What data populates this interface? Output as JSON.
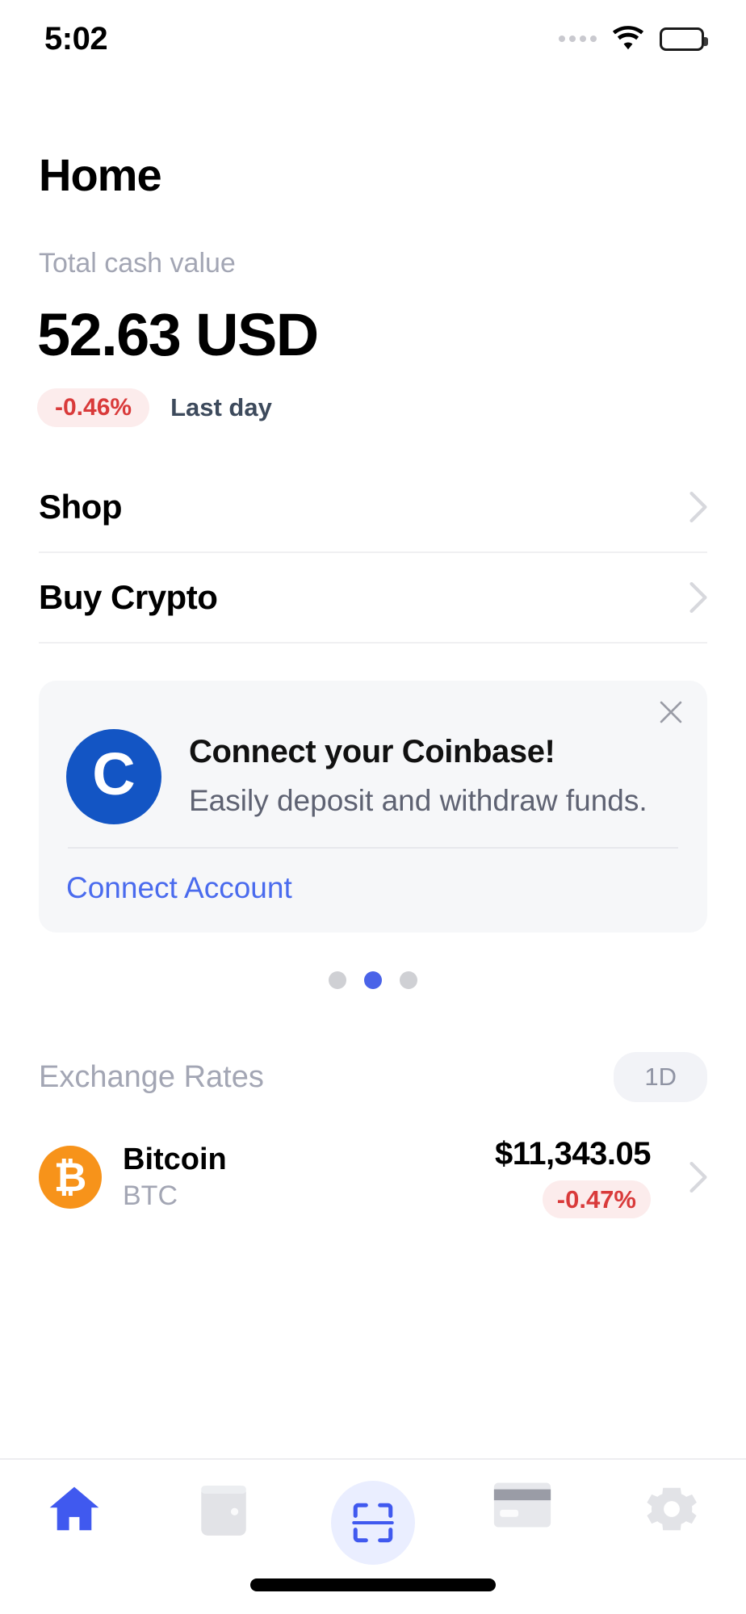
{
  "statusbar": {
    "time": "5:02",
    "signal_icon": "signal-dots-icon",
    "wifi_icon": "wifi-icon",
    "battery_icon": "battery-full-icon"
  },
  "header": {
    "title": "Home",
    "balance_label": "Total cash value",
    "balance_value": "52.63 USD",
    "change_percent": "-0.46%",
    "change_period": "Last day",
    "change_color": "#d93a3a",
    "change_bg": "#fcecec"
  },
  "nav_rows": [
    {
      "label": "Shop",
      "chevron": "chevron-right-icon"
    },
    {
      "label": "Buy Crypto",
      "chevron": "chevron-right-icon"
    }
  ],
  "promo": {
    "close_icon": "close-icon",
    "logo_letter": "C",
    "logo_color": "#1355c4",
    "title": "Connect your Coinbase!",
    "subtitle": "Easily deposit and withdraw funds.",
    "action_label": "Connect Account",
    "action_color": "#4a6bee"
  },
  "carousel": {
    "dots": [
      {
        "active": false
      },
      {
        "active": true
      },
      {
        "active": false
      }
    ],
    "active_color": "#4a63e8",
    "inactive_color": "#cfd0d4"
  },
  "exchange": {
    "title": "Exchange Rates",
    "range_label": "1D",
    "rows": [
      {
        "logo_letter": "₿",
        "logo_color": "#f7931a",
        "name": "Bitcoin",
        "ticker": "BTC",
        "price": "$11,343.05",
        "change": "-0.47%",
        "chevron": "chevron-right-icon"
      }
    ]
  },
  "tabbar": {
    "items": [
      {
        "name": "home-icon",
        "label": "Home",
        "active": true
      },
      {
        "name": "wallet-icon",
        "label": "Wallet",
        "active": false
      },
      {
        "name": "scan-icon",
        "label": "Scan",
        "active": true
      },
      {
        "name": "card-icon",
        "label": "Card",
        "active": false
      },
      {
        "name": "settings-icon",
        "label": "Settings",
        "active": false
      }
    ],
    "active_color": "#4059ef",
    "inactive_color": "#e2e3e7"
  }
}
